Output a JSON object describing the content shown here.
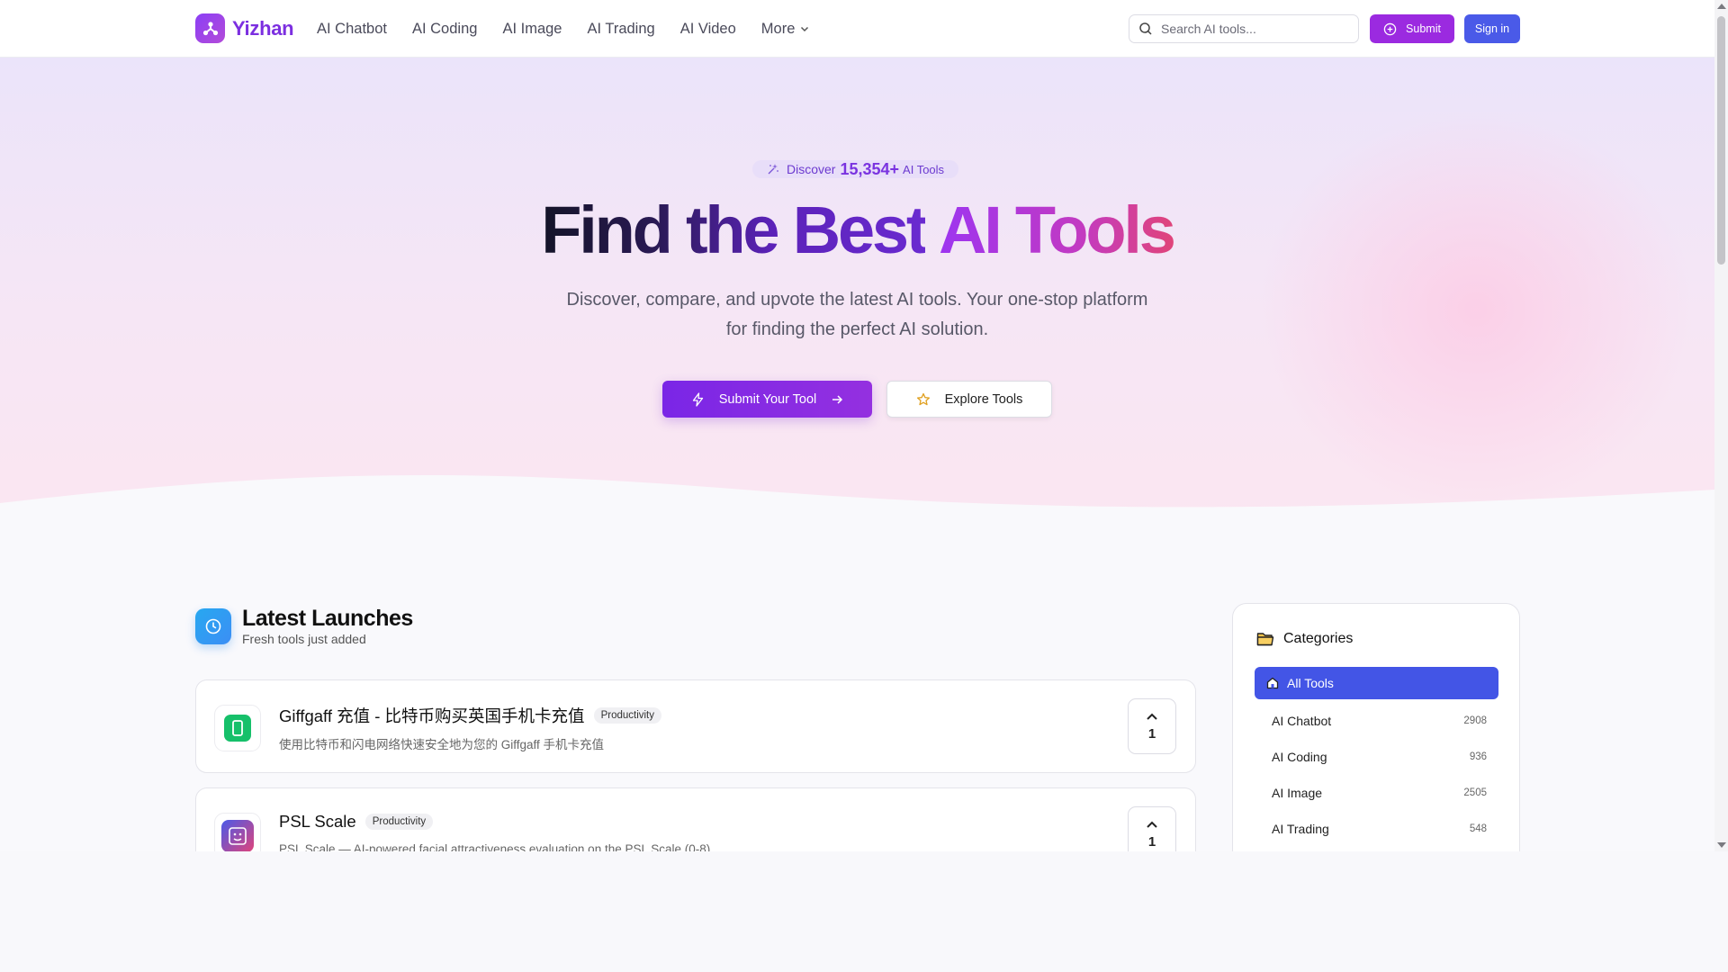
{
  "brand": {
    "name": "Yizhan"
  },
  "nav": [
    {
      "label": "AI Chatbot"
    },
    {
      "label": "AI Coding"
    },
    {
      "label": "AI Image"
    },
    {
      "label": "AI Trading"
    },
    {
      "label": "AI Video"
    },
    {
      "label": "More"
    }
  ],
  "search": {
    "placeholder": "Search AI tools..."
  },
  "header_buttons": {
    "submit": "Submit",
    "signin": "Sign in"
  },
  "hero": {
    "badge_prefix": "Discover",
    "badge_count": "15,354+",
    "badge_suffix": "AI Tools",
    "title_part1": "Find the Best",
    "title_part2": "AI Tools",
    "subtitle_line1": "Discover, compare, and upvote the latest AI tools. Your one-stop platform",
    "subtitle_line2": "for finding the perfect AI solution.",
    "primary_cta": "Submit Your Tool",
    "secondary_cta": "Explore Tools"
  },
  "latest": {
    "title": "Latest Launches",
    "subtitle": "Fresh tools just added",
    "items": [
      {
        "name": "Giffgaff 充值 - 比特币购买英国手机卡充值",
        "tag": "Productivity",
        "description": "使用比特币和闪电网络快速安全地为您的 Giffgaff 手机卡充值",
        "votes": "1",
        "icon": "phone-icon",
        "color": "#16c06a"
      },
      {
        "name": "PSL Scale",
        "tag": "Productivity",
        "description": "PSL Scale — AI-powered facial attractiveness evaluation on the PSL Scale (0-8)",
        "votes": "1",
        "icon": "face-scan-icon",
        "color": "#7a4ad8"
      }
    ]
  },
  "categories": {
    "title": "Categories",
    "items": [
      {
        "label": "All Tools",
        "count": ""
      },
      {
        "label": "AI Chatbot",
        "count": "2908"
      },
      {
        "label": "AI Coding",
        "count": "936"
      },
      {
        "label": "AI Image",
        "count": "2505"
      },
      {
        "label": "AI Trading",
        "count": "548"
      }
    ]
  },
  "colors": {
    "brand": "#7c2fe0",
    "submit_button": "#9b2ae0",
    "signin_button": "#4a5ae8",
    "active_category": "#4355e6"
  }
}
